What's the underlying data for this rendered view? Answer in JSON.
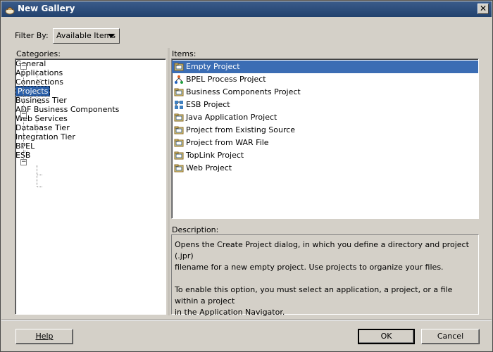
{
  "window": {
    "title": "New Gallery",
    "close_label": "✕"
  },
  "filter": {
    "label": "Filter By:",
    "value": "Available Items"
  },
  "categories": {
    "header": "Categories:",
    "nodes": [
      {
        "label": "General",
        "level": 0,
        "expander": "−"
      },
      {
        "label": "Applications",
        "level": 1
      },
      {
        "label": "Connections",
        "level": 1
      },
      {
        "label": "Projects",
        "level": 1,
        "selected": true
      },
      {
        "label": "Business Tier",
        "level": 0,
        "expander": "−"
      },
      {
        "label": "ADF Business Components",
        "level": 1
      },
      {
        "label": "Web Services",
        "level": 1
      },
      {
        "label": "Database Tier",
        "level": 0
      },
      {
        "label": "Integration Tier",
        "level": 0,
        "expander": "−"
      },
      {
        "label": "BPEL",
        "level": 1
      },
      {
        "label": "ESB",
        "level": 1
      }
    ]
  },
  "items": {
    "header": "Items:",
    "list": [
      {
        "label": "Empty Project",
        "icon": "folder-icon",
        "selected": true
      },
      {
        "label": "BPEL Process Project",
        "icon": "bpel-process-icon"
      },
      {
        "label": "Business Components Project",
        "icon": "folder-icon"
      },
      {
        "label": "ESB Project",
        "icon": "esb-icon"
      },
      {
        "label": "Java Application Project",
        "icon": "folder-icon"
      },
      {
        "label": "Project from Existing Source",
        "icon": "folder-icon"
      },
      {
        "label": "Project from WAR File",
        "icon": "folder-icon"
      },
      {
        "label": "TopLink Project",
        "icon": "folder-icon"
      },
      {
        "label": "Web Project",
        "icon": "folder-icon"
      }
    ]
  },
  "description": {
    "header": "Description:",
    "line1": "Opens the Create Project dialog, in which you define a directory and project (.jpr)",
    "line2": "filename for a new empty project. Use projects to organize your files.",
    "line3": "To enable this option, you must select an application, a project, or a file within a project",
    "line4": "in the Application Navigator."
  },
  "buttons": {
    "help": "Help",
    "ok": "OK",
    "cancel": "Cancel"
  },
  "colors": {
    "title_bar": "#2b4d7e",
    "selection": "#3b6db4",
    "dialog_bg": "#d4d0c8"
  }
}
